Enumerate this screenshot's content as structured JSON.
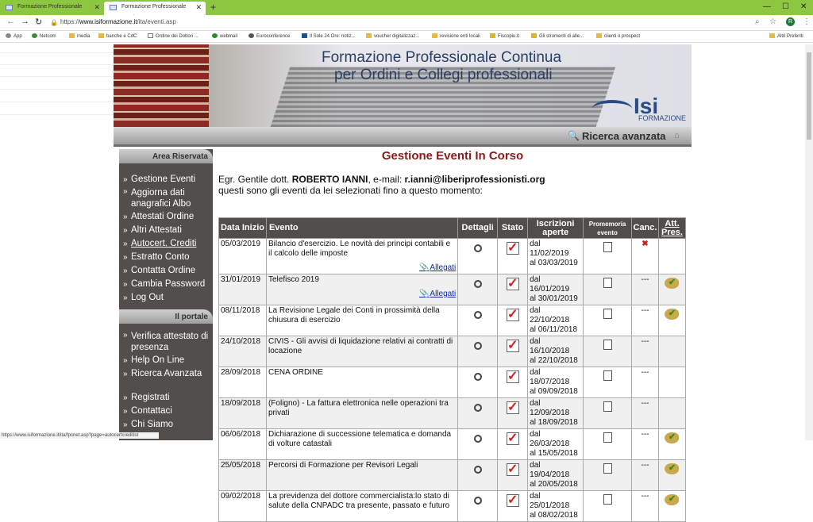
{
  "browser": {
    "tabs": [
      {
        "label": "Formazione Professionale Conti..."
      },
      {
        "label": "Formazione Professionale Conti..."
      }
    ],
    "url_prefix": "https://",
    "url_host": "www.isiformazione.it",
    "url_path": "/ita/eventi.asp",
    "profile_initial": "R",
    "bookmarks": [
      "App",
      "Netcom",
      "media",
      "banche e CdC",
      "Ordine dei Dottori ...",
      "webmail",
      "Euroconference",
      "Il Sole 24 Ore: notiz...",
      "voucher digitalizzaz...",
      "revisione enti locali",
      "Fiscopiu.it",
      "Gli strumenti di alle...",
      "clienti o prospect",
      "Altri Preferiti"
    ],
    "status_url": "https://www.isiformazione.it/ita/fpcnet.asp?page=autocertcreditist"
  },
  "banner": {
    "line1": "Formazione Professionale Continua",
    "line2": "per Ordini e Collegi professionali",
    "logo_text": "Isi",
    "logo_sub": "FORMAZIONE"
  },
  "topnav": {
    "search_label": "Ricerca avanzata"
  },
  "sidebar": {
    "area_title": "Area Riservata",
    "area_items": [
      "Gestione Eventi",
      "Aggiorna dati anagrafici Albo",
      "Attestati Ordine",
      "Altri Attestati",
      "Autocert. Crediti",
      "Estratto Conto",
      "Contatta Ordine",
      "Cambia Password",
      "Log Out"
    ],
    "portal_title": "Il portale",
    "portal_items": [
      "Verifica attestato di presenza",
      "Help On Line",
      "Ricerca Avanzata"
    ],
    "extra_items": [
      "Registrati",
      "Contattaci",
      "Chi Siamo"
    ]
  },
  "content": {
    "title": "Gestione Eventi In Corso",
    "greeting_prefix": "Egr. Gentile dott. ",
    "user_name": "ROBERTO IANNI",
    "email_prefix": ", e-mail: ",
    "email": "r.ianni@liberiprofessionisti.org",
    "greeting_line2": "questi sono gli eventi da lei selezionati fino a questo momento:"
  },
  "table": {
    "headers": [
      "Data Inizio",
      "Evento",
      "Dettagli",
      "Stato",
      "Iscrizioni aperte",
      "Promemoria evento",
      "Canc.",
      "Att. Pres."
    ],
    "allegati_label": "Allegati",
    "rows": [
      {
        "date": "05/03/2019",
        "event": "Bilancio d'esercizio. Le novità dei principi contabili e il calcolo delle imposte",
        "allegati": true,
        "from": "dal 11/02/2019",
        "to": "al 03/03/2019",
        "canc": "x",
        "att": false
      },
      {
        "date": "31/01/2019",
        "event": "Telefisco 2019",
        "allegati": true,
        "from": "dal 16/01/2019",
        "to": "al 30/01/2019",
        "canc": "---",
        "att": true
      },
      {
        "date": "08/11/2018",
        "event": "La Revisione Legale dei Conti in prossimità della chiusura di esercizio",
        "allegati": false,
        "from": "dal 22/10/2018",
        "to": "al 06/11/2018",
        "canc": "---",
        "att": true
      },
      {
        "date": "24/10/2018",
        "event": "CIVIS - Gli avvisi di liquidazione relativi ai contratti di locazione",
        "allegati": false,
        "from": "dal 16/10/2018",
        "to": "al 22/10/2018",
        "canc": "---",
        "att": false
      },
      {
        "date": "28/09/2018",
        "event": "CENA ORDINE",
        "allegati": false,
        "from": "dal 18/07/2018",
        "to": "al 09/09/2018",
        "canc": "---",
        "att": false
      },
      {
        "date": "18/09/2018",
        "event": "(Foligno) - La fattura elettronica nelle operazioni tra privati",
        "allegati": false,
        "from": "dal 12/09/2018",
        "to": "al 18/09/2018",
        "canc": "---",
        "att": false
      },
      {
        "date": "06/06/2018",
        "event": "Dichiarazione di successione telematica e domanda di volture catastali",
        "allegati": false,
        "from": "dal 26/03/2018",
        "to": "al 15/05/2018",
        "canc": "---",
        "att": true
      },
      {
        "date": "25/05/2018",
        "event": "Percorsi di Formazione per Revisori Legali",
        "allegati": false,
        "from": "dal 19/04/2018",
        "to": "al 20/05/2018",
        "canc": "---",
        "att": true
      },
      {
        "date": "09/02/2018",
        "event": "La previdenza del dottore commercialista:lo stato di salute della CNPADC tra presente, passato e futuro",
        "allegati": false,
        "from": "dal 25/01/2018",
        "to": "al 08/02/2018",
        "canc": "---",
        "att": true
      }
    ]
  }
}
